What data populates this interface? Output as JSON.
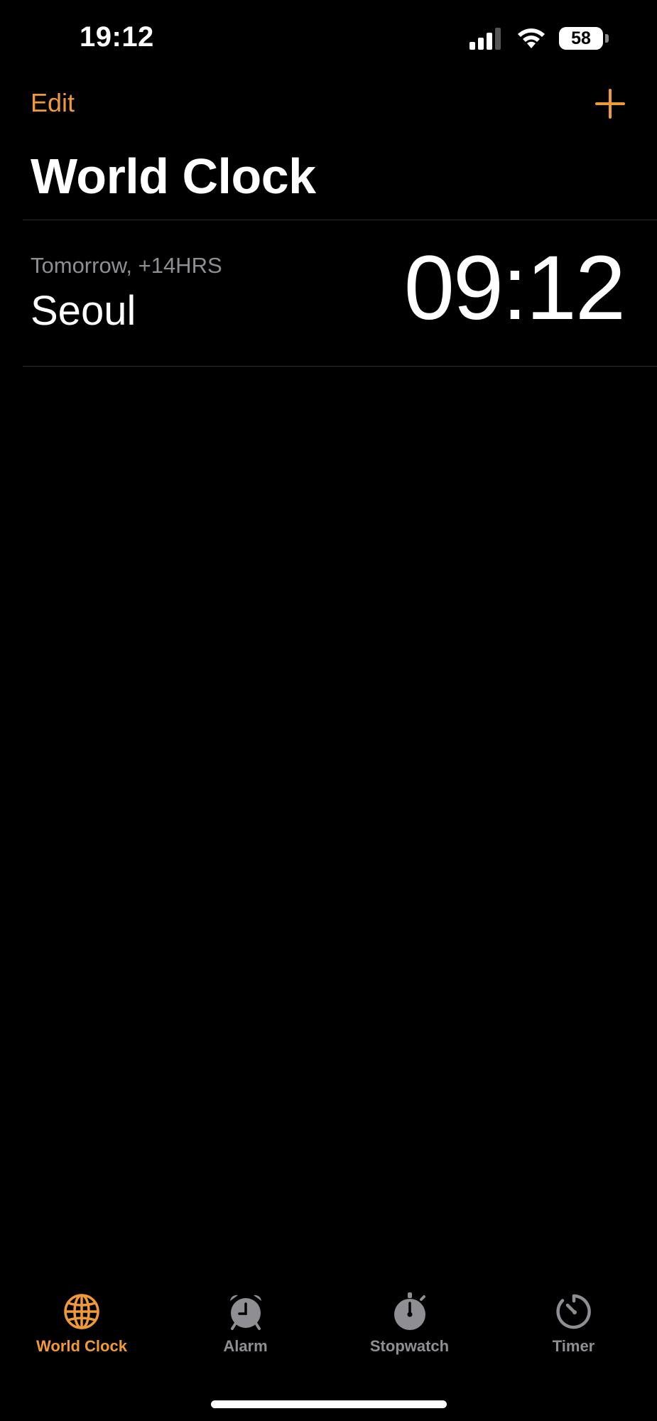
{
  "status_bar": {
    "time": "19:12",
    "battery": "58",
    "icons": [
      "signal-icon",
      "wifi-icon",
      "battery-icon"
    ]
  },
  "nav": {
    "edit_label": "Edit",
    "add_icon": "plus-icon",
    "title": "World Clock"
  },
  "clocks": [
    {
      "offset": "Tomorrow, +14HRS",
      "city": "Seoul",
      "time": "09:12"
    }
  ],
  "tabs": [
    {
      "label": "World Clock",
      "icon": "globe-icon",
      "active": true
    },
    {
      "label": "Alarm",
      "icon": "alarm-clock-icon",
      "active": false
    },
    {
      "label": "Stopwatch",
      "icon": "stopwatch-icon",
      "active": false
    },
    {
      "label": "Timer",
      "icon": "timer-icon",
      "active": false
    }
  ],
  "colors": {
    "accent": "#f09a37",
    "background": "#000000",
    "secondary_text": "#8e8e93",
    "divider": "#2a2a2c"
  }
}
